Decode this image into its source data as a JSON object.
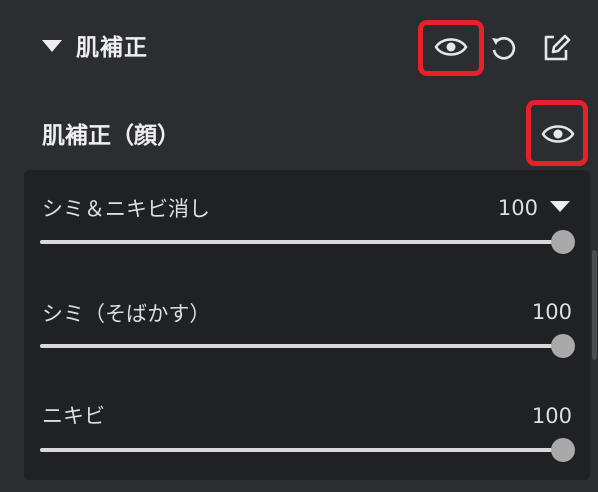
{
  "header": {
    "title": "肌補正",
    "icons": [
      "eye-icon",
      "undo-icon",
      "edit-icon"
    ]
  },
  "subsection": {
    "label": "肌補正（顔）",
    "icon": "eye-icon"
  },
  "sliders": [
    {
      "label": "シミ＆ニキビ消し",
      "value": "100",
      "level": 1.0,
      "has_dropdown": true
    },
    {
      "label": "シミ（そばかす）",
      "value": "100",
      "level": 1.0,
      "has_dropdown": false
    },
    {
      "label": "ニキビ",
      "value": "100",
      "level": 1.0,
      "has_dropdown": false
    }
  ],
  "colors": {
    "background": "#2b2d31",
    "panel": "#202124",
    "highlight": "#e8202a",
    "track": "#d9d9d9",
    "thumb": "#a9a9a9"
  }
}
